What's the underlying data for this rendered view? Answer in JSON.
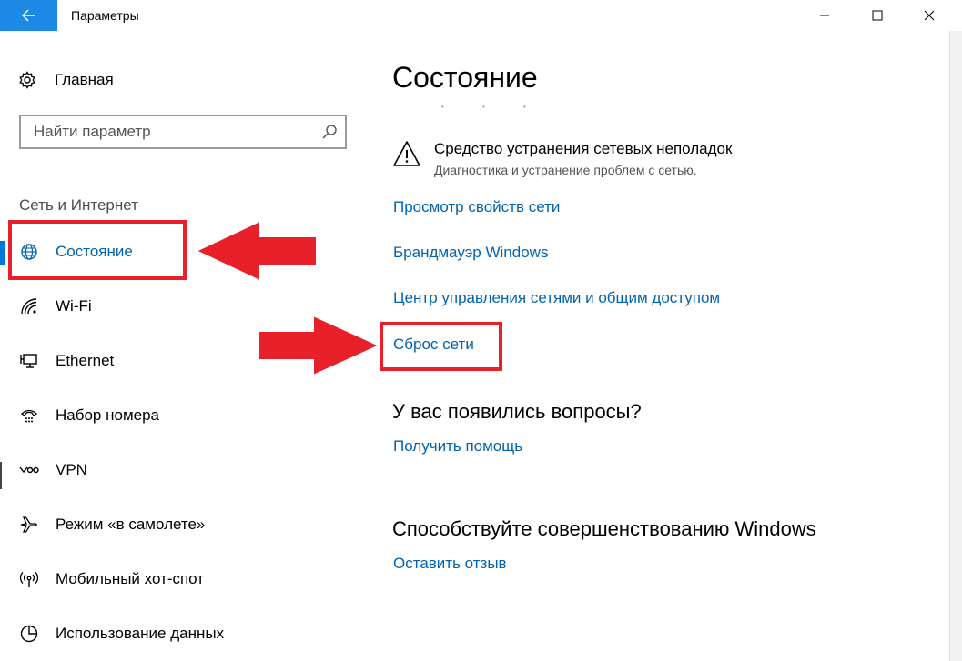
{
  "window": {
    "title": "Параметры",
    "icons": {
      "back": "back-arrow-icon",
      "minimize": "minimize-icon",
      "maximize": "maximize-icon",
      "close": "close-icon"
    }
  },
  "sidebar": {
    "home_label": "Главная",
    "search_placeholder": "Найти параметр",
    "section_title": "Сеть и Интернет",
    "items": [
      {
        "label": "Состояние",
        "icon": "globe-icon",
        "active": true
      },
      {
        "label": "Wi-Fi",
        "icon": "wifi-icon"
      },
      {
        "label": "Ethernet",
        "icon": "ethernet-icon"
      },
      {
        "label": "Набор номера",
        "icon": "dialup-icon"
      },
      {
        "label": "VPN",
        "icon": "vpn-icon"
      },
      {
        "label": "Режим «в самолете»",
        "icon": "airplane-icon"
      },
      {
        "label": "Мобильный хот-спот",
        "icon": "hotspot-icon"
      },
      {
        "label": "Использование данных",
        "icon": "data-usage-icon"
      }
    ]
  },
  "main": {
    "title": "Состояние",
    "troubleshooter": {
      "title": "Средство устранения сетевых неполадок",
      "subtitle": "Диагностика и устранение проблем с сетью."
    },
    "links": {
      "network_properties": "Просмотр свойств сети",
      "firewall": "Брандмауэр Windows",
      "sharing_center": "Центр управления сетями и общим доступом",
      "network_reset": "Сброс сети"
    },
    "questions": {
      "heading": "У вас появились вопросы?",
      "link": "Получить помощь"
    },
    "feedback": {
      "heading": "Способствуйте совершенствованию Windows",
      "link": "Оставить отзыв"
    }
  },
  "colors": {
    "accent": "#0078d7",
    "link": "#0063b1",
    "annotation_red": "#e8202a",
    "back_button": "#1e88e5"
  }
}
